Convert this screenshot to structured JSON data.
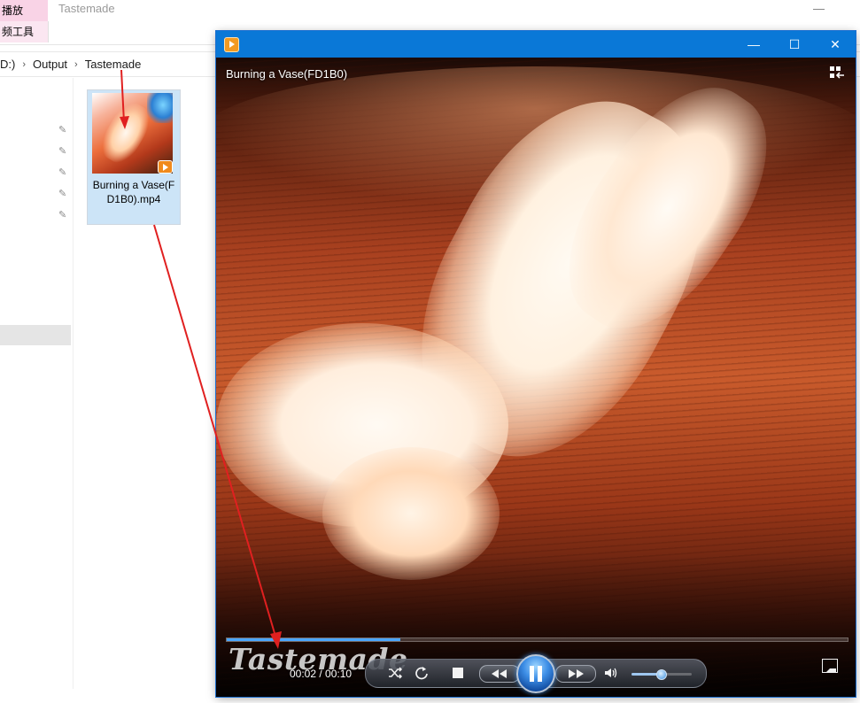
{
  "explorer": {
    "ribbon_tab_play": "播放",
    "ribbon_tab_video_tools": "频工具",
    "title": "Tastemade",
    "breadcrumb": [
      "D:)",
      "Output",
      "Tastemade"
    ],
    "file": {
      "name": "Burning a Vase(FD1B0).mp4"
    }
  },
  "player": {
    "video_title": "Burning a Vase(FD1B0)",
    "watermark": "Tastemade",
    "time": "00:02 / 00:10",
    "progress": 0.28,
    "volume": 0.48,
    "icons": {
      "app": "media-player-icon",
      "minimize": "minimize-icon",
      "maximize": "maximize-icon",
      "close": "close-icon",
      "switch_view": "switch-to-library-icon",
      "shuffle": "shuffle-icon",
      "repeat": "repeat-icon",
      "stop": "stop-icon",
      "rewind": "rewind-icon",
      "play_pause": "pause-icon",
      "fast_forward": "fast-forward-icon",
      "volume": "volume-icon",
      "fullscreen": "fullscreen-icon"
    },
    "colors": {
      "titlebar": "#0a78d7",
      "seek_fill": "#4aa6ff",
      "annotation": "#e02020"
    }
  }
}
